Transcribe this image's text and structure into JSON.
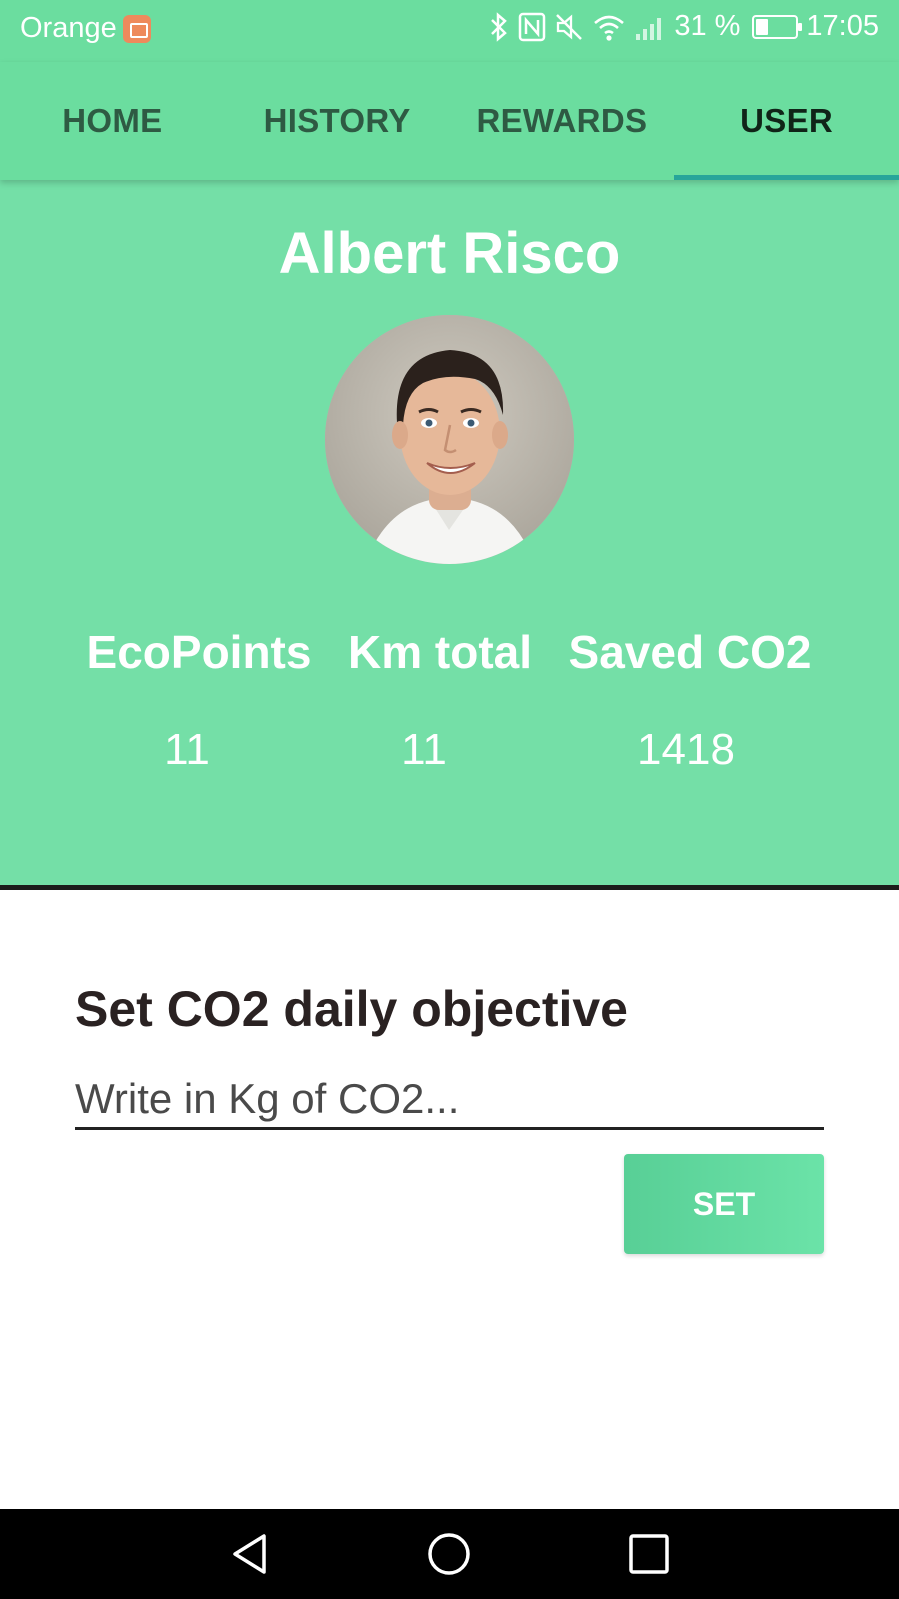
{
  "status_bar": {
    "carrier": "Orange",
    "signal_percent": "31 %",
    "time": "17:05",
    "battery_level": 0.31,
    "icons": [
      "bluetooth-icon",
      "nfc-icon",
      "mute-icon",
      "wifi-icon",
      "signal-icon",
      "battery-icon"
    ]
  },
  "tabs": [
    {
      "label": "HOME",
      "active": false
    },
    {
      "label": "HISTORY",
      "active": false
    },
    {
      "label": "REWARDS",
      "active": false
    },
    {
      "label": "USER",
      "active": true
    }
  ],
  "profile": {
    "name": "Albert Risco",
    "stats": [
      {
        "label": "EcoPoints",
        "value": "11"
      },
      {
        "label": "Km total",
        "value": "11"
      },
      {
        "label": "Saved CO2",
        "value": "1418"
      }
    ]
  },
  "objective": {
    "title": "Set CO2 daily objective",
    "input_value": "",
    "placeholder": "Write in Kg of CO2...",
    "button_label": "SET"
  },
  "nav_bar": {
    "icons": [
      "back-icon",
      "home-icon",
      "recents-icon"
    ]
  },
  "colors": {
    "header_green": "#6bdd9f",
    "profile_green": "#74dfa7",
    "tab_indicator": "#27a59a",
    "button_green": "#5ed69c"
  }
}
